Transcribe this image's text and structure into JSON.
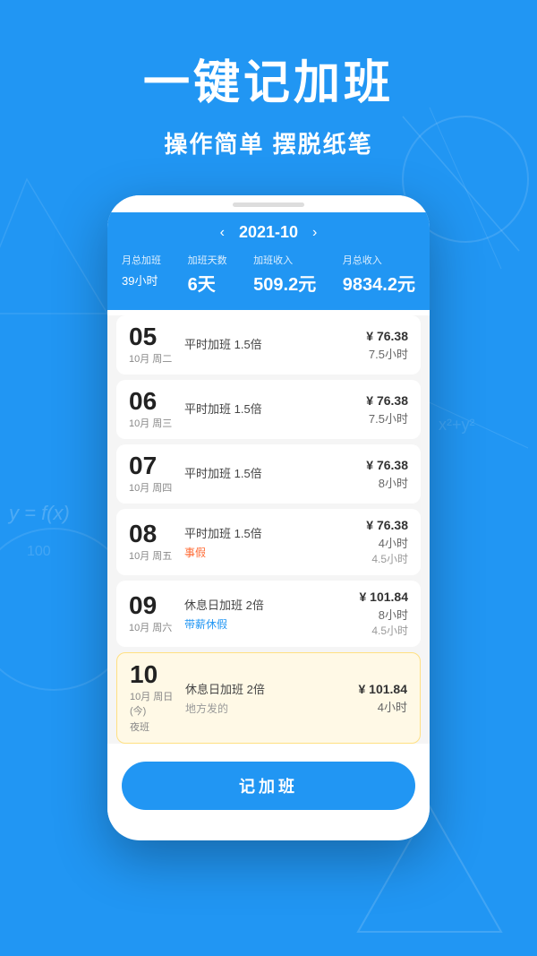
{
  "background_color": "#2196F3",
  "header": {
    "title": "一键记加班",
    "subtitle": "操作简单 摆脱纸笔"
  },
  "app": {
    "month_nav": {
      "prev_icon": "‹",
      "next_icon": "›",
      "current_month": "2021-10"
    },
    "stats": {
      "total_overtime_label": "月总加班",
      "total_overtime_value": "39",
      "total_overtime_unit": "小时",
      "overtime_days_label": "加班天数",
      "overtime_days_value": "6天",
      "overtime_income_label": "加班收入",
      "overtime_income_value": "509.2元",
      "monthly_income_label": "月总收入",
      "monthly_income_value": "9834.2元"
    },
    "records": [
      {
        "date_num": "05",
        "date_info": "10月 周二",
        "type": "平时加班 1.5倍",
        "tag": "",
        "tag_class": "",
        "pay": "¥ 76.38",
        "hours": "7.5小时",
        "hours2": "",
        "highlighted": false,
        "note": ""
      },
      {
        "date_num": "06",
        "date_info": "10月 周三",
        "type": "平时加班 1.5倍",
        "tag": "",
        "tag_class": "",
        "pay": "¥ 76.38",
        "hours": "7.5小时",
        "hours2": "",
        "highlighted": false,
        "note": ""
      },
      {
        "date_num": "07",
        "date_info": "10月 周四",
        "type": "平时加班 1.5倍",
        "tag": "",
        "tag_class": "",
        "pay": "¥ 76.38",
        "hours": "8小时",
        "hours2": "",
        "highlighted": false,
        "note": ""
      },
      {
        "date_num": "08",
        "date_info": "10月 周五",
        "type": "平时加班 1.5倍",
        "tag": "事假",
        "tag_class": "orange",
        "pay": "¥ 76.38",
        "hours": "4小时",
        "hours2": "4.5小时",
        "highlighted": false,
        "note": ""
      },
      {
        "date_num": "09",
        "date_info": "10月 周六",
        "type": "休息日加班 2倍",
        "tag": "带薪休假",
        "tag_class": "blue",
        "pay": "¥ 101.84",
        "hours": "8小时",
        "hours2": "4.5小时",
        "highlighted": false,
        "note": ""
      },
      {
        "date_num": "10",
        "date_info": "10月 周日(今)\n夜班",
        "type": "休息日加班 2倍",
        "tag": "",
        "tag_class": "",
        "pay": "¥ 101.84",
        "hours": "4小时",
        "hours2": "",
        "highlighted": true,
        "note": "地方发的"
      }
    ],
    "record_button_label": "记加班"
  }
}
